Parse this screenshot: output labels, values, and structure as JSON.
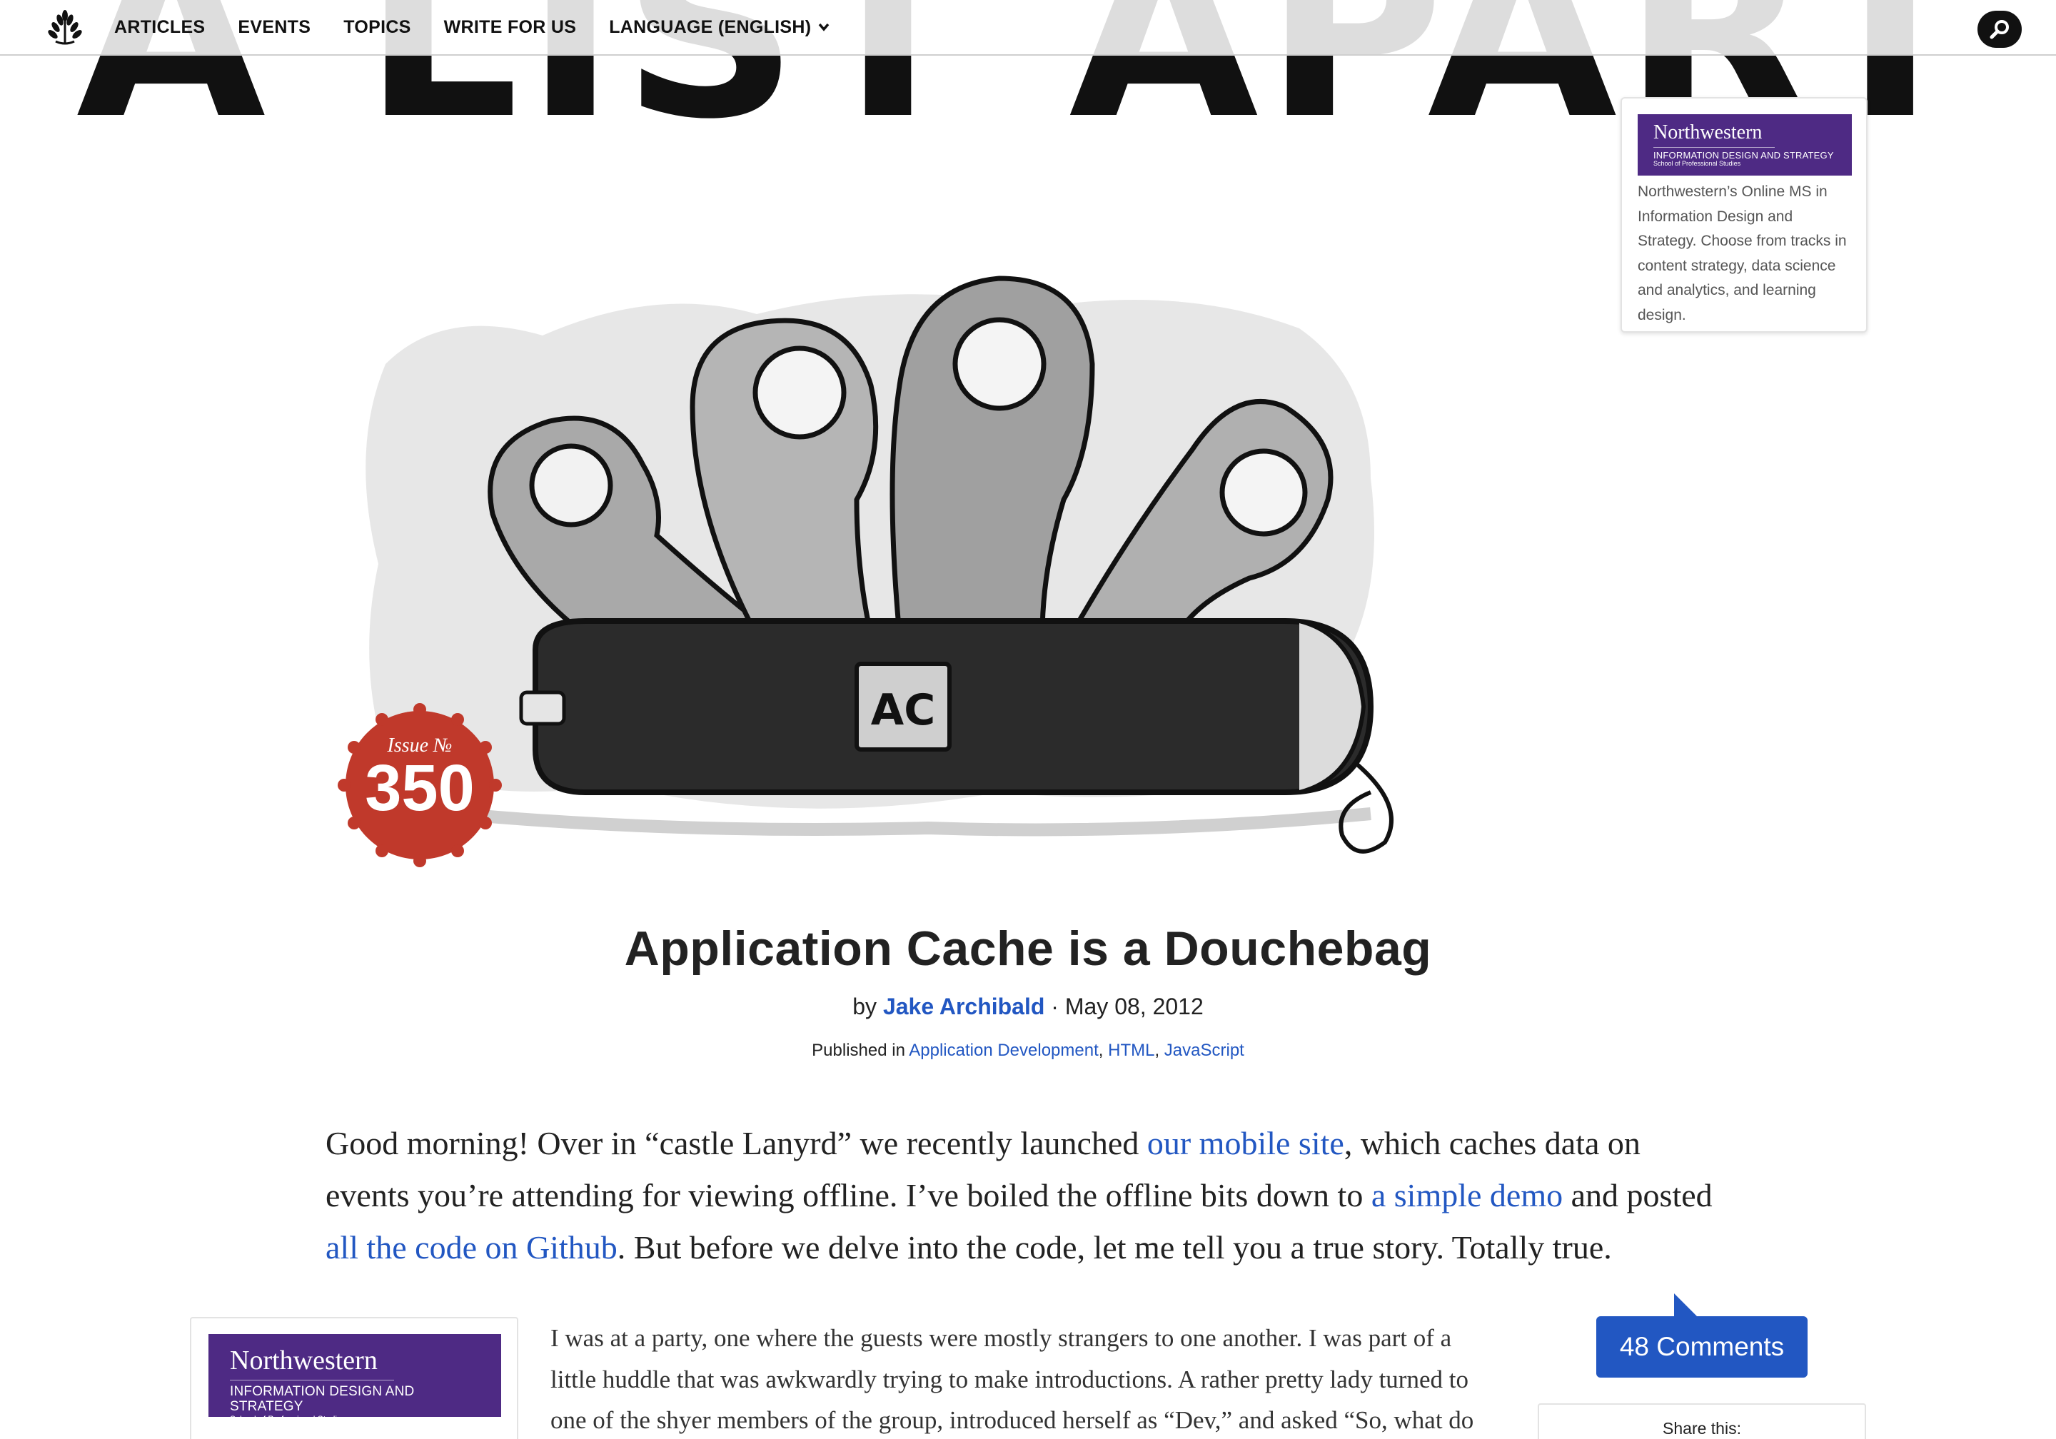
{
  "masthead": {
    "title": "A LIST APART"
  },
  "nav": {
    "items": [
      "ARTICLES",
      "EVENTS",
      "TOPICS",
      "WRITE FOR US",
      "LANGUAGE (ENGLISH)"
    ]
  },
  "icons": {
    "logo": "laurel-logo-icon",
    "search": "search-icon",
    "language_dropdown": "chevron-down-icon"
  },
  "hero": {
    "badge_label_1": "AC"
  },
  "issue": {
    "label": "Issue №",
    "number": "350"
  },
  "ad_top": {
    "brand": "Northwestern",
    "program": "INFORMATION DESIGN AND STRATEGY",
    "school": "School of Professional Studies",
    "copy": "Northwestern’s Online MS in Information Design and Strategy. Choose from tracks in content strategy, data science and analytics, and learning design."
  },
  "article": {
    "title": "Application Cache is a Douchebag",
    "by_prefix": "by",
    "author": "Jake Archibald",
    "separator": "·",
    "date": "May 08, 2012",
    "published_prefix": "Published in",
    "categories": [
      "Application Development",
      "HTML",
      "JavaScript"
    ],
    "intro": {
      "t1": "Good morning! Over in “castle Lanyrd” we recently launched ",
      "l1": "our mobile site",
      "t2": ", which caches data on events you’re attending for viewing offline. I’ve boiled the offline bits down to ",
      "l2": "a simple demo",
      "t3": " and posted ",
      "l3": "all the code on Github",
      "t4": ". But before we delve into the code, let me tell you a true story. Totally true."
    },
    "body_1": "I was at a party, one where the guests were mostly strangers to one another. I was part of a little huddle that was awkwardly trying to make introductions. A rather pretty lady turned to one of the shyer members of the group, introduced herself as “Dev,” and asked “So, what do you do"
  },
  "ad_left": {
    "brand": "Northwestern",
    "program": "INFORMATION DESIGN AND STRATEGY",
    "school": "School of Professional Studies"
  },
  "comments": {
    "label": "48 Comments"
  },
  "share": {
    "label": "Share this:"
  },
  "colors": {
    "link": "#2257c2",
    "northwestern_purple": "#4e2a84",
    "issue_red": "#c0392b",
    "text": "#222222"
  }
}
